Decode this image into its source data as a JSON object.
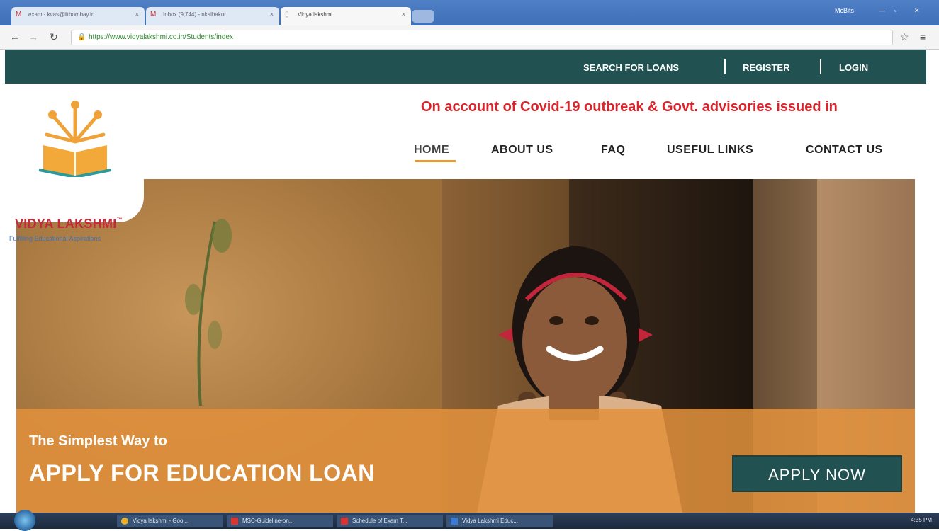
{
  "browser": {
    "tabs": [
      {
        "label": "exam - kvas@iitbombay.in",
        "favicon": "gmail-icon"
      },
      {
        "label": "Inbox (9,744) - nkalhakur",
        "favicon": "gmail-icon"
      },
      {
        "label": "Vidya lakshmi",
        "favicon": "page-icon"
      }
    ],
    "user": "McBits",
    "url": "https://www.vidyalakshmi.co.in/Students/index"
  },
  "site": {
    "topnav": {
      "search_label": "SEARCH FOR LOANS",
      "register_label": "REGISTER",
      "login_label": "LOGIN"
    },
    "notice": "On account of Covid-19 outbreak & Govt. advisories issued in",
    "menu": {
      "home": "HOME",
      "about": "ABOUT US",
      "faq": "FAQ",
      "links": "USEFUL LINKS",
      "contact": "CONTACT US"
    },
    "logo": {
      "brand": "VIDYA LAKSHMI",
      "tm": "™",
      "tagline": "Fulfilling Educational Aspirations"
    },
    "hero": {
      "tagline": "The Simplest Way to",
      "headline": "APPLY FOR EDUCATION LOAN",
      "button": "APPLY NOW"
    }
  },
  "taskbar": {
    "tasks": [
      {
        "label": "Vidya lakshmi - Goo..."
      },
      {
        "label": "MSC-Guideline-on..."
      },
      {
        "label": "Schedule of Exam T..."
      },
      {
        "label": "Vidya Lakshmi Educ..."
      }
    ],
    "time": "4:35 PM"
  },
  "colors": {
    "brand_teal": "#215151",
    "notice_red": "#d9242c",
    "accent_orange": "#e89a2f"
  }
}
